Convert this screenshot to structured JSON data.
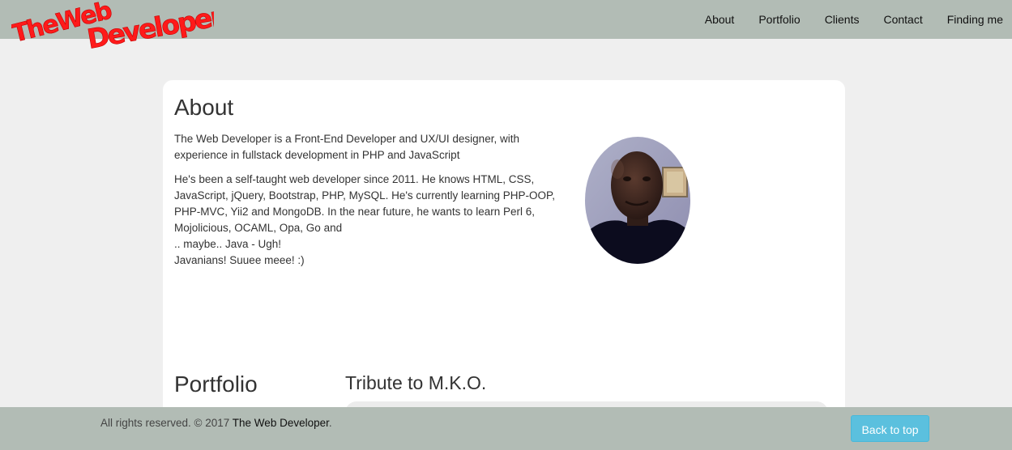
{
  "brand": {
    "logo_text_1": "TheWeb",
    "logo_text_2": "Developer",
    "logo_color": "#ff1a1a"
  },
  "nav": {
    "items": [
      {
        "label": "About"
      },
      {
        "label": "Portfolio"
      },
      {
        "label": "Clients"
      },
      {
        "label": "Contact"
      },
      {
        "label": "Finding me"
      }
    ]
  },
  "about": {
    "title": "About",
    "paragraph1": "The Web Developer is a Front-End Developer and UX/UI designer, with experience in fullstack development in PHP and JavaScript",
    "paragraph2": "He's been a self-taught web developer since 2011. He knows HTML, CSS, JavaScript, jQuery, Bootstrap, PHP, MySQL. He's currently learning PHP-OOP, PHP-MVC, Yii2 and MongoDB. In the near future, he wants to learn Perl 6, Mojolicious, OCAML, Opa, Go and",
    "paragraph2_line2": ".. maybe.. Java - Ugh!",
    "paragraph2_line3": "Javanians! Suuee meee! :)"
  },
  "portfolio": {
    "title": "Portfolio",
    "featured_title": "Tribute to M.K.O."
  },
  "footer": {
    "copyright": "All rights reserved. © 2017",
    "brand": "The Web Developer",
    "period": ".",
    "back_to_top": "Back to top"
  },
  "colors": {
    "navbar_bg": "#b2bcb5",
    "page_bg": "#efefef",
    "card_bg": "#ffffff",
    "button_info": "#5bc0de"
  }
}
